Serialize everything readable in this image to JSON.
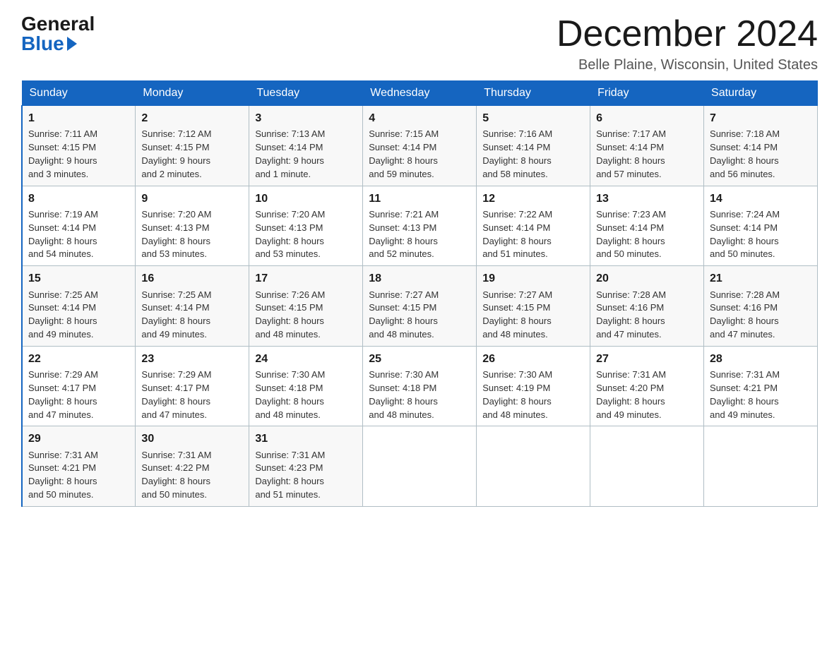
{
  "header": {
    "logo_general": "General",
    "logo_blue": "Blue",
    "title": "December 2024",
    "location": "Belle Plaine, Wisconsin, United States"
  },
  "days_of_week": [
    "Sunday",
    "Monday",
    "Tuesday",
    "Wednesday",
    "Thursday",
    "Friday",
    "Saturday"
  ],
  "weeks": [
    [
      {
        "day": "1",
        "sunrise": "7:11 AM",
        "sunset": "4:15 PM",
        "daylight": "9 hours and 3 minutes."
      },
      {
        "day": "2",
        "sunrise": "7:12 AM",
        "sunset": "4:15 PM",
        "daylight": "9 hours and 2 minutes."
      },
      {
        "day": "3",
        "sunrise": "7:13 AM",
        "sunset": "4:14 PM",
        "daylight": "9 hours and 1 minute."
      },
      {
        "day": "4",
        "sunrise": "7:15 AM",
        "sunset": "4:14 PM",
        "daylight": "8 hours and 59 minutes."
      },
      {
        "day": "5",
        "sunrise": "7:16 AM",
        "sunset": "4:14 PM",
        "daylight": "8 hours and 58 minutes."
      },
      {
        "day": "6",
        "sunrise": "7:17 AM",
        "sunset": "4:14 PM",
        "daylight": "8 hours and 57 minutes."
      },
      {
        "day": "7",
        "sunrise": "7:18 AM",
        "sunset": "4:14 PM",
        "daylight": "8 hours and 56 minutes."
      }
    ],
    [
      {
        "day": "8",
        "sunrise": "7:19 AM",
        "sunset": "4:14 PM",
        "daylight": "8 hours and 54 minutes."
      },
      {
        "day": "9",
        "sunrise": "7:20 AM",
        "sunset": "4:13 PM",
        "daylight": "8 hours and 53 minutes."
      },
      {
        "day": "10",
        "sunrise": "7:20 AM",
        "sunset": "4:13 PM",
        "daylight": "8 hours and 53 minutes."
      },
      {
        "day": "11",
        "sunrise": "7:21 AM",
        "sunset": "4:13 PM",
        "daylight": "8 hours and 52 minutes."
      },
      {
        "day": "12",
        "sunrise": "7:22 AM",
        "sunset": "4:14 PM",
        "daylight": "8 hours and 51 minutes."
      },
      {
        "day": "13",
        "sunrise": "7:23 AM",
        "sunset": "4:14 PM",
        "daylight": "8 hours and 50 minutes."
      },
      {
        "day": "14",
        "sunrise": "7:24 AM",
        "sunset": "4:14 PM",
        "daylight": "8 hours and 50 minutes."
      }
    ],
    [
      {
        "day": "15",
        "sunrise": "7:25 AM",
        "sunset": "4:14 PM",
        "daylight": "8 hours and 49 minutes."
      },
      {
        "day": "16",
        "sunrise": "7:25 AM",
        "sunset": "4:14 PM",
        "daylight": "8 hours and 49 minutes."
      },
      {
        "day": "17",
        "sunrise": "7:26 AM",
        "sunset": "4:15 PM",
        "daylight": "8 hours and 48 minutes."
      },
      {
        "day": "18",
        "sunrise": "7:27 AM",
        "sunset": "4:15 PM",
        "daylight": "8 hours and 48 minutes."
      },
      {
        "day": "19",
        "sunrise": "7:27 AM",
        "sunset": "4:15 PM",
        "daylight": "8 hours and 48 minutes."
      },
      {
        "day": "20",
        "sunrise": "7:28 AM",
        "sunset": "4:16 PM",
        "daylight": "8 hours and 47 minutes."
      },
      {
        "day": "21",
        "sunrise": "7:28 AM",
        "sunset": "4:16 PM",
        "daylight": "8 hours and 47 minutes."
      }
    ],
    [
      {
        "day": "22",
        "sunrise": "7:29 AM",
        "sunset": "4:17 PM",
        "daylight": "8 hours and 47 minutes."
      },
      {
        "day": "23",
        "sunrise": "7:29 AM",
        "sunset": "4:17 PM",
        "daylight": "8 hours and 47 minutes."
      },
      {
        "day": "24",
        "sunrise": "7:30 AM",
        "sunset": "4:18 PM",
        "daylight": "8 hours and 48 minutes."
      },
      {
        "day": "25",
        "sunrise": "7:30 AM",
        "sunset": "4:18 PM",
        "daylight": "8 hours and 48 minutes."
      },
      {
        "day": "26",
        "sunrise": "7:30 AM",
        "sunset": "4:19 PM",
        "daylight": "8 hours and 48 minutes."
      },
      {
        "day": "27",
        "sunrise": "7:31 AM",
        "sunset": "4:20 PM",
        "daylight": "8 hours and 49 minutes."
      },
      {
        "day": "28",
        "sunrise": "7:31 AM",
        "sunset": "4:21 PM",
        "daylight": "8 hours and 49 minutes."
      }
    ],
    [
      {
        "day": "29",
        "sunrise": "7:31 AM",
        "sunset": "4:21 PM",
        "daylight": "8 hours and 50 minutes."
      },
      {
        "day": "30",
        "sunrise": "7:31 AM",
        "sunset": "4:22 PM",
        "daylight": "8 hours and 50 minutes."
      },
      {
        "day": "31",
        "sunrise": "7:31 AM",
        "sunset": "4:23 PM",
        "daylight": "8 hours and 51 minutes."
      },
      null,
      null,
      null,
      null
    ]
  ],
  "labels": {
    "sunrise": "Sunrise:",
    "sunset": "Sunset:",
    "daylight": "Daylight:"
  }
}
